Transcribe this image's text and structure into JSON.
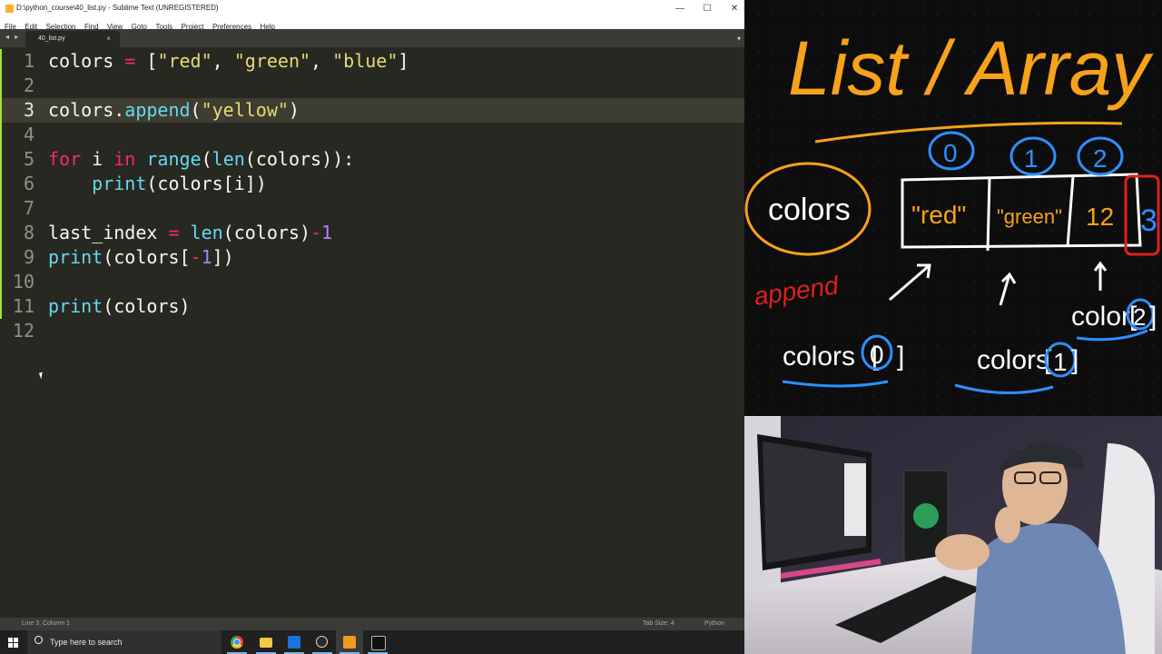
{
  "window": {
    "title": "D:\\python_course\\40_list.py - Sublime Text (UNREGISTERED)",
    "controls": {
      "minimize": "—",
      "maximize": "☐",
      "close": "✕"
    }
  },
  "menu": [
    "File",
    "Edit",
    "Selection",
    "Find",
    "View",
    "Goto",
    "Tools",
    "Project",
    "Preferences",
    "Help"
  ],
  "tabs": {
    "nav": "◂ ▸",
    "active": "40_list.py",
    "close": "×",
    "dropdown": "▾"
  },
  "editor": {
    "current_line": 3,
    "lines": [
      {
        "num": "1",
        "tokens": [
          {
            "t": "colors ",
            "c": ""
          },
          {
            "t": "=",
            "c": "op"
          },
          {
            "t": " [",
            "c": ""
          },
          {
            "t": "\"red\"",
            "c": "str"
          },
          {
            "t": ", ",
            "c": ""
          },
          {
            "t": "\"green\"",
            "c": "str"
          },
          {
            "t": ", ",
            "c": ""
          },
          {
            "t": "\"blue\"",
            "c": "str"
          },
          {
            "t": "]",
            "c": ""
          }
        ]
      },
      {
        "num": "2",
        "tokens": []
      },
      {
        "num": "3",
        "tokens": [
          {
            "t": "colors.",
            "c": ""
          },
          {
            "t": "append",
            "c": "fn"
          },
          {
            "t": "(",
            "c": ""
          },
          {
            "t": "\"yellow\"",
            "c": "str"
          },
          {
            "t": ")",
            "c": ""
          }
        ]
      },
      {
        "num": "4",
        "tokens": []
      },
      {
        "num": "5",
        "tokens": [
          {
            "t": "for",
            "c": "op"
          },
          {
            "t": " i ",
            "c": ""
          },
          {
            "t": "in",
            "c": "op"
          },
          {
            "t": " ",
            "c": ""
          },
          {
            "t": "range",
            "c": "fn"
          },
          {
            "t": "(",
            "c": ""
          },
          {
            "t": "len",
            "c": "fn"
          },
          {
            "t": "(colors)):",
            "c": ""
          }
        ]
      },
      {
        "num": "6",
        "tokens": [
          {
            "t": "    ",
            "c": ""
          },
          {
            "t": "print",
            "c": "fn"
          },
          {
            "t": "(colors[i])",
            "c": ""
          }
        ]
      },
      {
        "num": "7",
        "tokens": []
      },
      {
        "num": "8",
        "tokens": [
          {
            "t": "last_index ",
            "c": ""
          },
          {
            "t": "=",
            "c": "op"
          },
          {
            "t": " ",
            "c": ""
          },
          {
            "t": "len",
            "c": "fn"
          },
          {
            "t": "(colors)",
            "c": ""
          },
          {
            "t": "-",
            "c": "op"
          },
          {
            "t": "1",
            "c": "num"
          }
        ]
      },
      {
        "num": "9",
        "tokens": [
          {
            "t": "print",
            "c": "fn"
          },
          {
            "t": "(colors[",
            "c": ""
          },
          {
            "t": "-",
            "c": "op"
          },
          {
            "t": "1",
            "c": "num"
          },
          {
            "t": "])",
            "c": ""
          }
        ]
      },
      {
        "num": "10",
        "tokens": []
      },
      {
        "num": "11",
        "tokens": [
          {
            "t": "print",
            "c": "fn"
          },
          {
            "t": "(colors)",
            "c": ""
          }
        ]
      },
      {
        "num": "12",
        "tokens": []
      }
    ]
  },
  "status": {
    "position": "Line 3, Column 1",
    "tab_size": "Tab Size: 4",
    "syntax": "Python"
  },
  "taskbar": {
    "search_placeholder": "Type here to search",
    "apps": [
      "chrome-icon",
      "file-explorer-icon",
      "mail-icon",
      "obs-icon",
      "sublime-icon",
      "terminal-icon"
    ]
  },
  "whiteboard": {
    "title": "List / Array",
    "variable": "colors",
    "indices": [
      "0",
      "1",
      "2"
    ],
    "cells": [
      "\"red\"",
      "\"green\"",
      "12",
      "3"
    ],
    "method": "append",
    "access_labels": [
      {
        "text": "colors",
        "index": "0"
      },
      {
        "text": "colors",
        "index": "1"
      },
      {
        "text": "color",
        "index": "2"
      }
    ]
  },
  "colors": {
    "editor_bg": "#272822",
    "keyword": "#f92672",
    "string": "#e6db74",
    "function": "#66d9ef",
    "number": "#ae81ff",
    "board_orange": "#f7a21b",
    "board_blue": "#2f8fff",
    "board_red": "#e01f1f"
  }
}
